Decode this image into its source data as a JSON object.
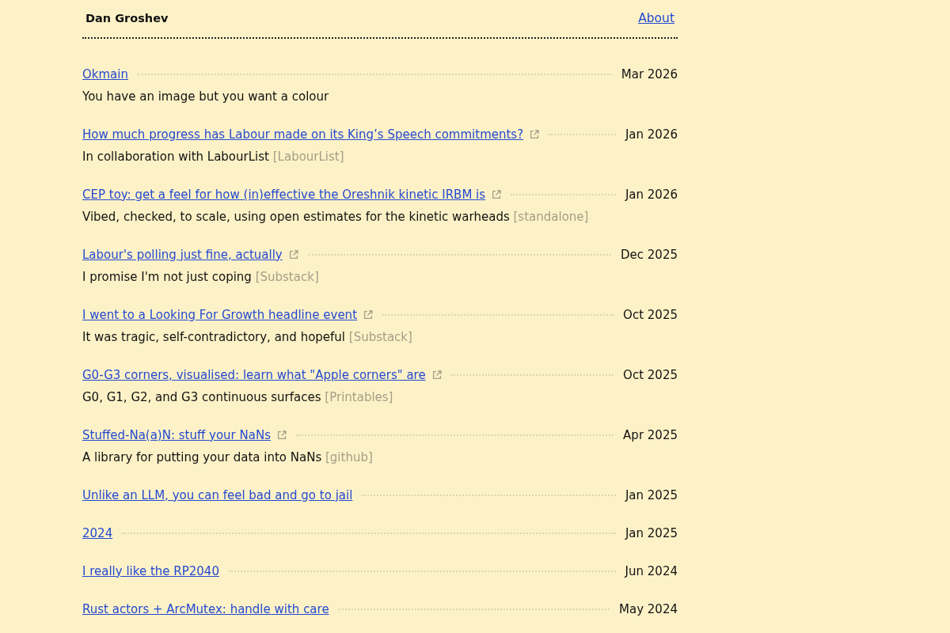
{
  "header": {
    "site_title": "Dan Groshev",
    "nav_link": "About"
  },
  "posts": [
    {
      "title": "Okmain",
      "external": false,
      "date": "Mar 2026",
      "description": "You have an image but you want a colour"
    },
    {
      "title": "How much progress has Labour made on its King’s Speech commitments?",
      "external": true,
      "date": "Jan 2026",
      "description": "In collaboration with LabourList",
      "source": "[LabourList]"
    },
    {
      "title": "CEP toy: get a feel for how (in)effective the Oreshnik kinetic IRBM is",
      "external": true,
      "date": "Jan 2026",
      "description": "Vibed, checked, to scale, using open estimates for the kinetic warheads",
      "source": "[standalone]"
    },
    {
      "title": "Labour's polling just fine, actually",
      "external": true,
      "date": "Dec 2025",
      "description": "I promise I'm not just coping",
      "source": "[Substack]"
    },
    {
      "title": "I went to a Looking For Growth headline event",
      "external": true,
      "date": "Oct 2025",
      "description": "It was tragic, self-contradictory, and hopeful",
      "source": "[Substack]"
    },
    {
      "title": "G0-G3 corners, visualised: learn what \"Apple corners\" are",
      "external": true,
      "date": "Oct 2025",
      "description": "G0, G1, G2, and G3 continuous surfaces",
      "source": "[Printables]"
    },
    {
      "title": "Stuffed-Na(a)N: stuff your NaNs",
      "external": true,
      "date": "Apr 2025",
      "description": "A library for putting your data into NaNs",
      "source": "[github]"
    },
    {
      "title": "Unlike an LLM, you can feel bad and go to jail",
      "external": false,
      "date": "Jan 2025"
    },
    {
      "title": "2024",
      "external": false,
      "date": "Jan 2025"
    },
    {
      "title": "I really like the RP2040",
      "external": false,
      "date": "Jun 2024"
    },
    {
      "title": "Rust actors + ArcMutex: handle with care",
      "external": false,
      "date": "May 2024"
    }
  ]
}
